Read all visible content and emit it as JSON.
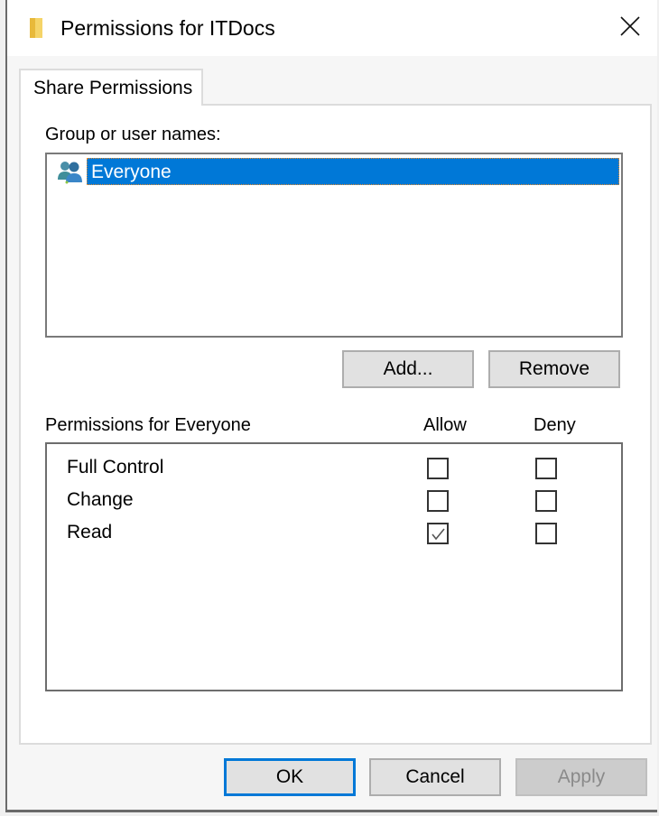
{
  "window": {
    "title": "Permissions for ITDocs",
    "icon": "folder-icon",
    "close_icon": "close-icon"
  },
  "tabs": [
    {
      "label": "Share Permissions",
      "active": true
    }
  ],
  "group_section": {
    "label": "Group or user names:",
    "items": [
      {
        "name": "Everyone",
        "icon": "users-group-icon",
        "selected": true
      }
    ],
    "add_label": "Add...",
    "remove_label": "Remove"
  },
  "permissions_section": {
    "label": "Permissions for Everyone",
    "allow_header": "Allow",
    "deny_header": "Deny",
    "rows": [
      {
        "name": "Full Control",
        "allow": false,
        "deny": false
      },
      {
        "name": "Change",
        "allow": false,
        "deny": false
      },
      {
        "name": "Read",
        "allow": true,
        "deny": false
      }
    ]
  },
  "footer": {
    "ok_label": "OK",
    "cancel_label": "Cancel",
    "apply_label": "Apply",
    "apply_enabled": false
  },
  "colors": {
    "selection": "#0078d7",
    "default_button_border": "#0078d7"
  }
}
